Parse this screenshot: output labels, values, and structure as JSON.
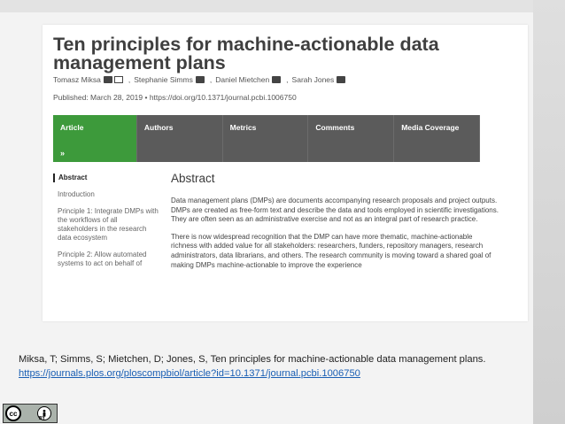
{
  "article": {
    "title": "Ten principles for machine-actionable data management plans",
    "authors": [
      "Tomasz Miksa",
      "Stephanie Simms",
      "Daniel Mietchen",
      "Sarah Jones"
    ],
    "published": "Published: March 28, 2019  •  https://doi.org/10.1371/journal.pcbi.1006750"
  },
  "tabs": [
    {
      "label": "Article"
    },
    {
      "label": "Authors"
    },
    {
      "label": "Metrics"
    },
    {
      "label": "Comments"
    },
    {
      "label": "Media Coverage"
    }
  ],
  "tab_chevron": "»",
  "sidebar": {
    "items": [
      {
        "label": "Abstract"
      },
      {
        "label": "Introduction"
      },
      {
        "label": "Principle 1: Integrate DMPs with the workflows of all stakeholders in the research data ecosystem"
      },
      {
        "label": "Principle 2: Allow automated systems to act on behalf of"
      }
    ]
  },
  "abstract": {
    "heading": "Abstract",
    "paragraphs": [
      "Data management plans (DMPs) are documents accompanying research proposals and project outputs. DMPs are created as free-form text and describe the data and tools employed in scientific investigations. They are often seen as an administrative exercise and not as an integral part of research practice.",
      "There is now widespread recognition that the DMP can have more thematic, machine-actionable richness with added value for all stakeholders: researchers, funders, repository managers, research administrators, data librarians, and others. The research community is moving toward a shared goal of making DMPs machine-actionable to improve the experience"
    ]
  },
  "caption": {
    "text": "Miksa, T; Simms, S; Mietchen, D; Jones, S, Ten principles for machine-actionable data management plans.",
    "link": "https://journals.plos.org/ploscompbiol/article?id=10.1371/journal.pcbi.1006750"
  },
  "license": {
    "cc": "cc",
    "by": "BY"
  },
  "colors": {
    "accent_green": "#3d9a3b",
    "tab_gray": "#5b5b5b",
    "link_blue": "#1a5fb4"
  }
}
